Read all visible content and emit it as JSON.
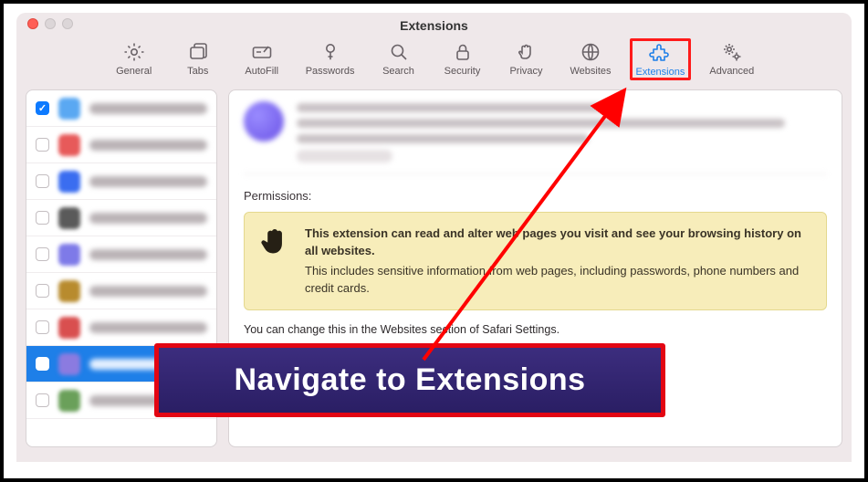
{
  "window": {
    "title": "Extensions"
  },
  "toolbar": {
    "items": [
      {
        "label": "General"
      },
      {
        "label": "Tabs"
      },
      {
        "label": "AutoFill"
      },
      {
        "label": "Passwords"
      },
      {
        "label": "Search"
      },
      {
        "label": "Security"
      },
      {
        "label": "Privacy"
      },
      {
        "label": "Websites"
      },
      {
        "label": "Extensions"
      },
      {
        "label": "Advanced"
      }
    ]
  },
  "sidebar": {
    "items": [
      {
        "checked": true,
        "color": "#5aa8f2",
        "selected": false
      },
      {
        "checked": false,
        "color": "#e75a5a",
        "selected": false
      },
      {
        "checked": false,
        "color": "#3a6df0",
        "selected": false
      },
      {
        "checked": false,
        "color": "#5a5a5a",
        "selected": false
      },
      {
        "checked": false,
        "color": "#7e7ae8",
        "selected": false
      },
      {
        "checked": false,
        "color": "#b88b2e",
        "selected": false
      },
      {
        "checked": false,
        "color": "#d94f4f",
        "selected": false
      },
      {
        "checked": false,
        "color": "#8b7be0",
        "selected": true
      },
      {
        "checked": false,
        "color": "#6aa05a",
        "selected": false
      }
    ]
  },
  "main": {
    "permissions_label": "Permissions:",
    "perm_title": "This extension can read and alter web pages you visit and see your browsing history on all websites.",
    "perm_body": "This includes sensitive information from web pages, including passwords, phone numbers and credit cards.",
    "perm_note": "You can change this in the Websites section of Safari Settings."
  },
  "callout": {
    "text": "Navigate to Extensions"
  }
}
